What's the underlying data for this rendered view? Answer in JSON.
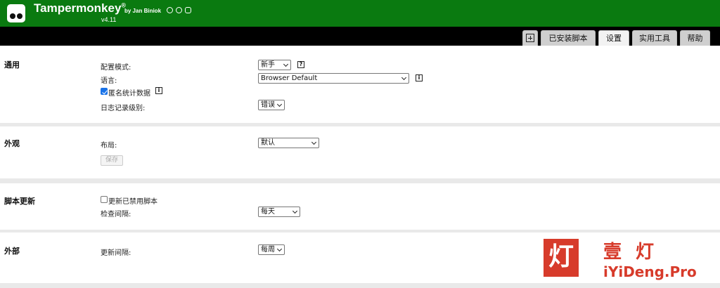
{
  "header": {
    "app_name": "Tampermonkey",
    "registered": "®",
    "byline": "by Jan Biniok",
    "version": "v4.11",
    "social_icons": [
      "github-icon",
      "facebook-icon",
      "instagram-icon"
    ],
    "background_color": "#0a7a10"
  },
  "tabs": {
    "items": [
      {
        "label": "已安装脚本"
      },
      {
        "label": "设置",
        "active": true
      },
      {
        "label": "实用工具"
      },
      {
        "label": "帮助"
      }
    ]
  },
  "general": {
    "title": "通用",
    "config_mode_label": "配置模式:",
    "config_mode_value": "新手",
    "help_icon_glyph": "?",
    "language_label": "语言:",
    "language_value": "Browser Default",
    "info_icon_glyph": "i",
    "anon_stats_label": "匿名统计数据",
    "anon_stats_checked": true,
    "log_level_label": "日志记录级别:",
    "log_level_value": "错误"
  },
  "appearance": {
    "title": "外观",
    "layout_label": "布局:",
    "layout_value": "默认",
    "save_label": "保存"
  },
  "script_update": {
    "title": "脚本更新",
    "update_disabled_label": "更新已禁用脚本",
    "update_disabled_checked": false,
    "check_interval_label": "检查间隔:",
    "check_interval_value": "每天"
  },
  "external": {
    "title": "外部",
    "update_interval_label": "更新间隔:",
    "update_interval_value": "每周"
  },
  "watermark": {
    "logo_char": "灯",
    "brand_cn": "壹灯",
    "brand_url": "iYiDeng.Pro",
    "color": "#d73b2b"
  }
}
